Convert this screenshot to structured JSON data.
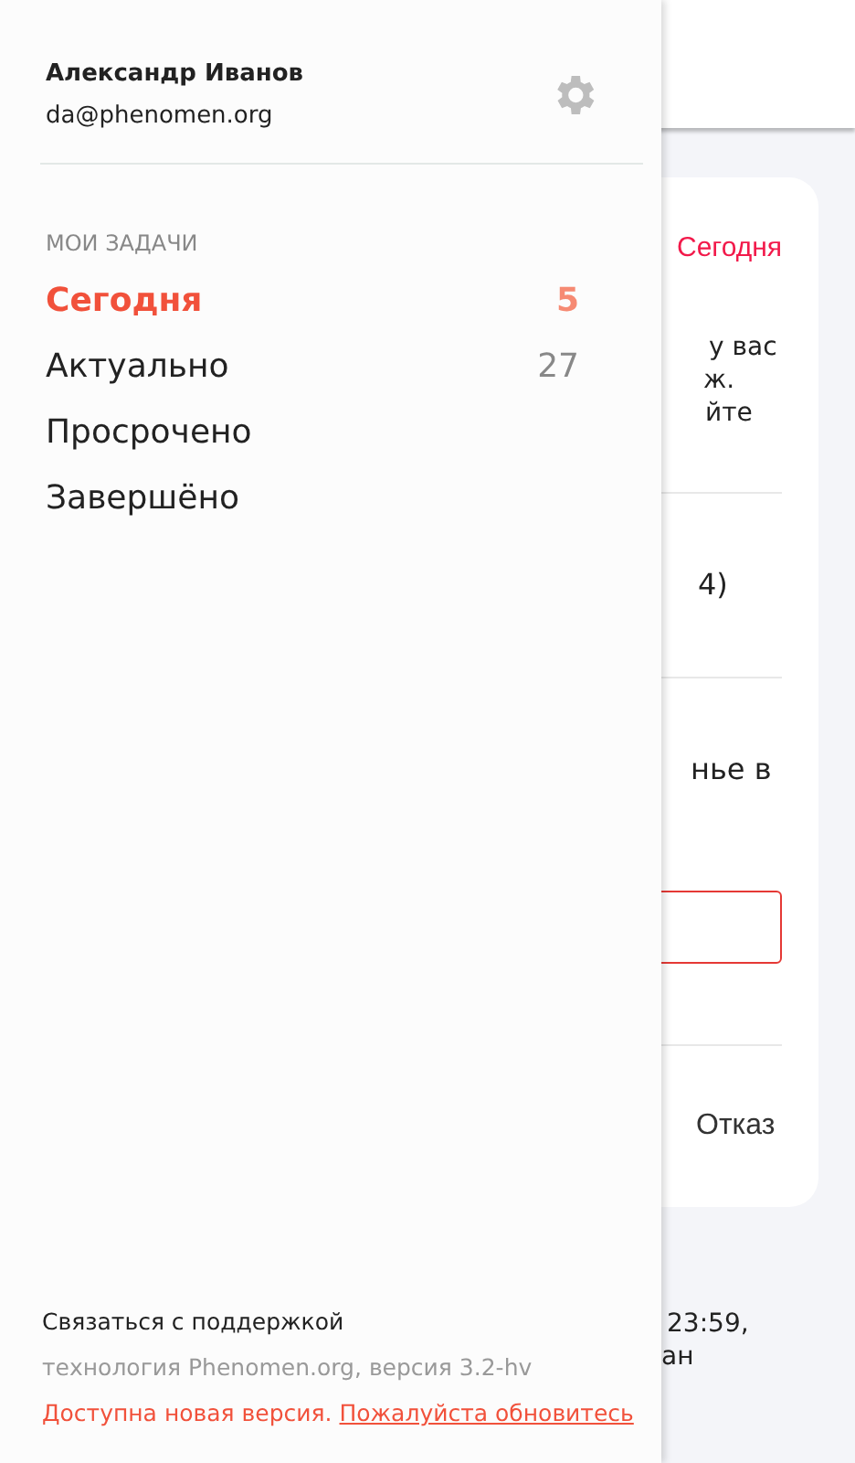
{
  "drawer": {
    "user_name": "Александр Иванов",
    "email": "da@phenomen.org",
    "section_title": "МОИ ЗАДАЧИ",
    "menu": [
      {
        "label": "Сегодня",
        "count": "5",
        "selected": true
      },
      {
        "label": "Актуально",
        "count": "27",
        "selected": false
      },
      {
        "label": "Просрочено",
        "selected": false
      },
      {
        "label": "Завершёно",
        "selected": false
      }
    ],
    "support": "Связаться с поддержкой",
    "version": "технология Phenomen.org, версия 3.2-hv",
    "update_notice": "Доступна новая версия.",
    "update_link": "Пожалуйста обновитесь"
  },
  "task": {
    "due": "Сегодня",
    "description_lines": [
      "у вас",
      "ж.",
      "йте"
    ],
    "products": [
      {
        "name_lines": [
          "4)"
        ]
      },
      {
        "name_lines": [
          "нье в"
        ]
      }
    ],
    "decline_button": "Отказ",
    "note_lines": [
      "23:59,",
      "ан"
    ]
  }
}
